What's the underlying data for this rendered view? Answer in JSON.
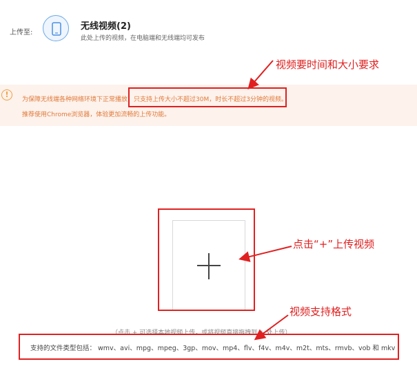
{
  "header": {
    "upload_to_label": "上传至:",
    "title": "无线视频(2)",
    "subtitle": "此处上传的视频，在电脑端和无线端均可发布",
    "phone_icon": "mobile-phone-icon"
  },
  "notice": {
    "icon": "warning-circle-icon",
    "line1_prefix": "为保障无线端各种网络环境下正常播放，",
    "line1_highlight": "只支持上传大小不超过30M，时长不超过3分钟的视频。",
    "line2": "推荐使用Chrome浏览器，体验更加流畅的上传功能。"
  },
  "upload": {
    "plus_icon": "plus-icon",
    "hint": "（点击 + 可选择本地视频上传，或将视频直接拖拽到 + 处上传）",
    "formats": "支持的文件类型包括： wmv、avi、mpg、mpeg、3gp、mov、mp4、flv、f4v、m4v、m2t、mts、rmvb、vob 和 mkv"
  },
  "annotations": {
    "size_requirement": "视频要时间和大小要求",
    "click_plus": "点击“+”上传视频",
    "formats_supported": "视频支持格式"
  },
  "colors": {
    "annotation_red": "#e02020",
    "notice_bg": "#fdf2ec",
    "notice_text": "#e07a3a",
    "accent_blue": "#6aa8e8"
  }
}
